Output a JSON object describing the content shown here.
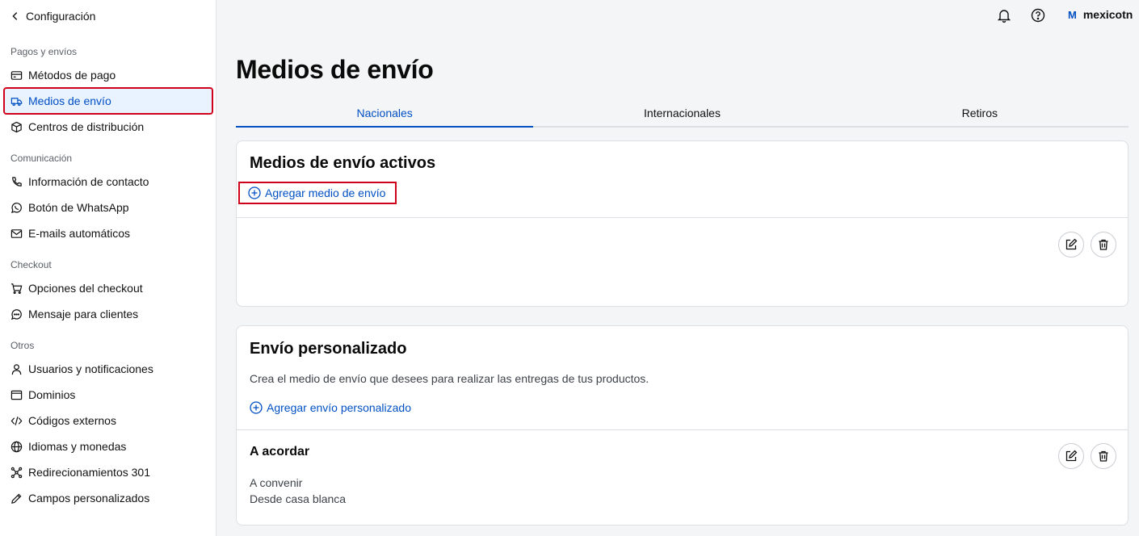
{
  "sidebar": {
    "back_label": "Configuración",
    "groups": [
      {
        "label": "Pagos y envíos",
        "items": [
          {
            "label": "Métodos de pago",
            "icon": "credit-card-icon"
          },
          {
            "label": "Medios de envío",
            "icon": "truck-icon",
            "active": true
          },
          {
            "label": "Centros de distribución",
            "icon": "box-icon"
          }
        ]
      },
      {
        "label": "Comunicación",
        "items": [
          {
            "label": "Información de contacto",
            "icon": "phone-icon"
          },
          {
            "label": "Botón de WhatsApp",
            "icon": "whatsapp-icon"
          },
          {
            "label": "E-mails automáticos",
            "icon": "mail-icon"
          }
        ]
      },
      {
        "label": "Checkout",
        "items": [
          {
            "label": "Opciones del checkout",
            "icon": "cart-icon"
          },
          {
            "label": "Mensaje para clientes",
            "icon": "chat-icon"
          }
        ]
      },
      {
        "label": "Otros",
        "items": [
          {
            "label": "Usuarios y notificaciones",
            "icon": "user-icon"
          },
          {
            "label": "Dominios",
            "icon": "browser-icon"
          },
          {
            "label": "Códigos externos",
            "icon": "code-icon"
          },
          {
            "label": "Idiomas y monedas",
            "icon": "globe-icon"
          },
          {
            "label": "Redirecionamientos 301",
            "icon": "redirect-icon"
          },
          {
            "label": "Campos personalizados",
            "icon": "pencil-icon"
          }
        ]
      }
    ]
  },
  "topbar": {
    "user_initial": "M",
    "user_name": "mexicotn"
  },
  "main": {
    "title": "Medios de envío",
    "tabs": [
      {
        "label": "Nacionales",
        "active": true
      },
      {
        "label": "Internacionales"
      },
      {
        "label": "Retiros"
      }
    ],
    "active_card": {
      "title": "Medios de envío activos",
      "add_label": "Agregar medio de envío"
    },
    "custom_card": {
      "title": "Envío personalizado",
      "description": "Crea el medio de envío que desees para realizar las entregas de tus productos.",
      "add_label": "Agregar envío personalizado",
      "item": {
        "title": "A acordar",
        "line1": "A convenir",
        "line2": "Desde casa blanca"
      }
    }
  },
  "colors": {
    "accent": "#0050c3",
    "highlight_box": "#d0021b",
    "active_bg": "#e9f2ff"
  }
}
